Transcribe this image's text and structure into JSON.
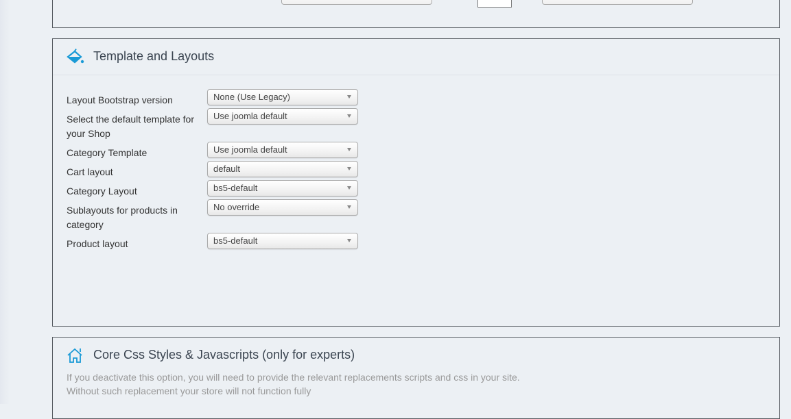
{
  "template_section": {
    "title": "Template and Layouts",
    "icon": "paint-bucket-icon",
    "accent_color": "#1a9ad6",
    "fields": [
      {
        "label": "Layout Bootstrap version",
        "value": "None (Use Legacy)"
      },
      {
        "label": "Select the default template for your Shop",
        "value": "Use joomla default"
      },
      {
        "label": "Category Template",
        "value": "Use joomla default"
      },
      {
        "label": "Cart layout",
        "value": "default"
      },
      {
        "label": "Category Layout",
        "value": "bs5-default"
      },
      {
        "label": "Sublayouts for products in category",
        "value": "No override"
      },
      {
        "label": "Product layout",
        "value": "bs5-default"
      }
    ]
  },
  "core_section": {
    "title": "Core Css Styles & Javascripts (only for experts)",
    "icon": "home-icon",
    "description_line1": "If you deactivate this option, you will need to provide the relevant replacements scripts and css in your site.",
    "description_line2": "Without such replacement your store will not function fully"
  }
}
